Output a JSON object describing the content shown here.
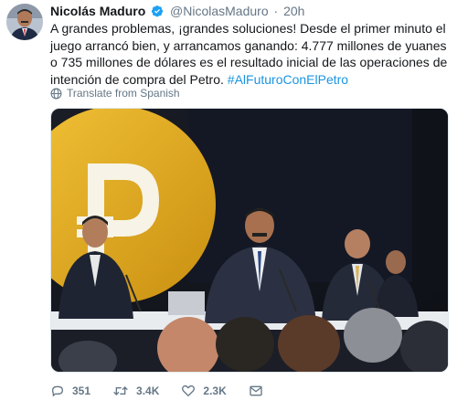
{
  "user": {
    "display_name": "Nicolás Maduro",
    "handle": "@NicolasMaduro",
    "separator": "·",
    "time": "20h"
  },
  "tweet": {
    "text": "A grandes problemas, ¡grandes soluciones! Desde el primer minuto el juego arrancó bien, y arrancamos ganando: 4.777 millones de yuanes o 735 millones de dólares es el resultado inicial de las operaciones de intención de compra del Petro.",
    "hashtag": "#AlFuturoConElPetro",
    "translate_label": "Translate from Spanish"
  },
  "actions": {
    "replies": "351",
    "retweets": "3.4K",
    "likes": "2.3K"
  },
  "icons": {
    "verified": "verified-badge-icon",
    "translate": "globe-icon",
    "reply": "reply-icon",
    "retweet": "retweet-icon",
    "like": "heart-icon",
    "message": "envelope-icon"
  },
  "colors": {
    "accent": "#1b95e0",
    "muted": "#657786",
    "text": "#14171a",
    "petro_gold": "#d9a520"
  }
}
